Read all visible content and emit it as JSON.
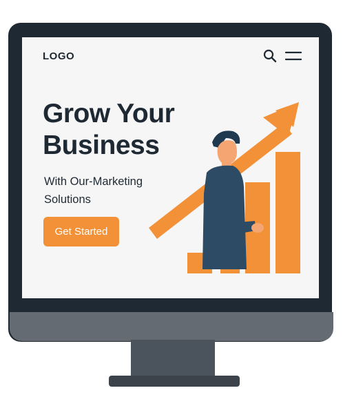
{
  "header": {
    "logo_text": "LOGO",
    "search_icon": "search-icon",
    "menu_icon": "hamburger-menu-icon"
  },
  "hero": {
    "title": "Grow Your Business",
    "subtitle": "With Our-Marketing Solutions",
    "cta_label": "Get Started"
  },
  "colors": {
    "accent": "#f29138",
    "dark": "#1f2933",
    "screen_bg": "#f6f6f6",
    "bezel": "#1f2933"
  },
  "illustration": {
    "icon": "growth-chart-person-illustration"
  }
}
